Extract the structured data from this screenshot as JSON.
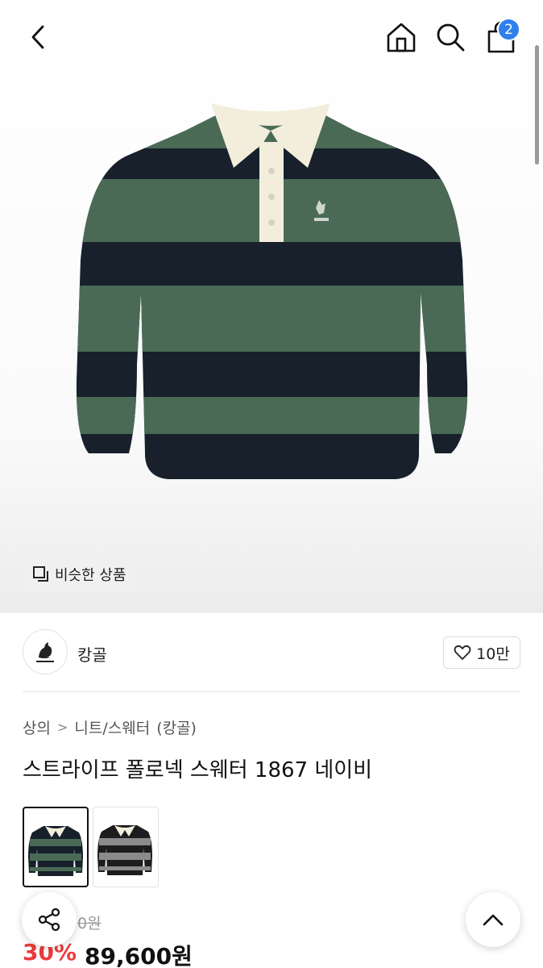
{
  "header": {
    "back_icon": "chevron-left-icon",
    "home_icon": "home-icon",
    "search_icon": "search-icon",
    "bag_icon": "shopping-bag-icon",
    "cart_count": "2",
    "badge_color": "#2f80ed"
  },
  "image": {
    "similar_label": "비슷한 상품",
    "similar_icon": "copy-icon",
    "colors": {
      "navy": "#17202b",
      "green": "#4a6a55",
      "collar": "#f3eedc"
    }
  },
  "brand": {
    "name": "캉골",
    "logo_text": "KANGOL",
    "like_count": "10만",
    "like_icon": "heart-icon"
  },
  "breadcrumb": {
    "level1": "상의",
    "separator": ">",
    "level2": "니트/스웨터",
    "brand_tag": "(캉골)"
  },
  "product": {
    "title": "스트라이프 폴로넥 스웨터 1867 네이비",
    "thumbnails": [
      {
        "name": "navy-green",
        "selected": true
      },
      {
        "name": "gray-black",
        "selected": false
      }
    ],
    "original_price": "0원",
    "discount": "30%",
    "price": "89,600원",
    "discount_color": "#ec3a3a"
  },
  "floating": {
    "share_icon": "share-icon",
    "scroll_top_icon": "chevron-up-icon"
  }
}
